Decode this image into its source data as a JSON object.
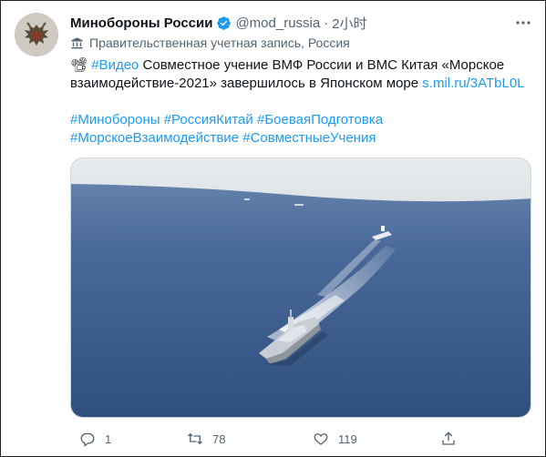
{
  "tweet": {
    "author_name": "Минобороны России",
    "handle": "@mod_russia",
    "separator": "·",
    "time": "2小时",
    "gov_label": "Правительственная учетная запись, Россия",
    "emoji": "📽",
    "video_tag": "#Видео",
    "text_part1": " Совместное учение ВМФ России и ВМС Китая «Морское взаимодействие-2021» завершилось в Японском море ",
    "link": "s.mil.ru/3ATbL0L",
    "hashtags_line1": [
      "#Минобороны",
      "#РоссияКитай",
      "#БоеваяПодготовка"
    ],
    "hashtags_line2": [
      "#МорскоеВзаимодействие",
      "#СовместныеУчения"
    ]
  },
  "actions": {
    "reply_count": "1",
    "retweet_count": "78",
    "like_count": "119"
  },
  "colors": {
    "link": "#1d9bf0",
    "verified": "#1d9bf0",
    "secondary_text": "#536471",
    "sea": "#3a5a86"
  },
  "icons": [
    "verified-badge-icon",
    "more-icon",
    "government-icon",
    "reply-icon",
    "retweet-icon",
    "like-icon",
    "share-icon"
  ]
}
